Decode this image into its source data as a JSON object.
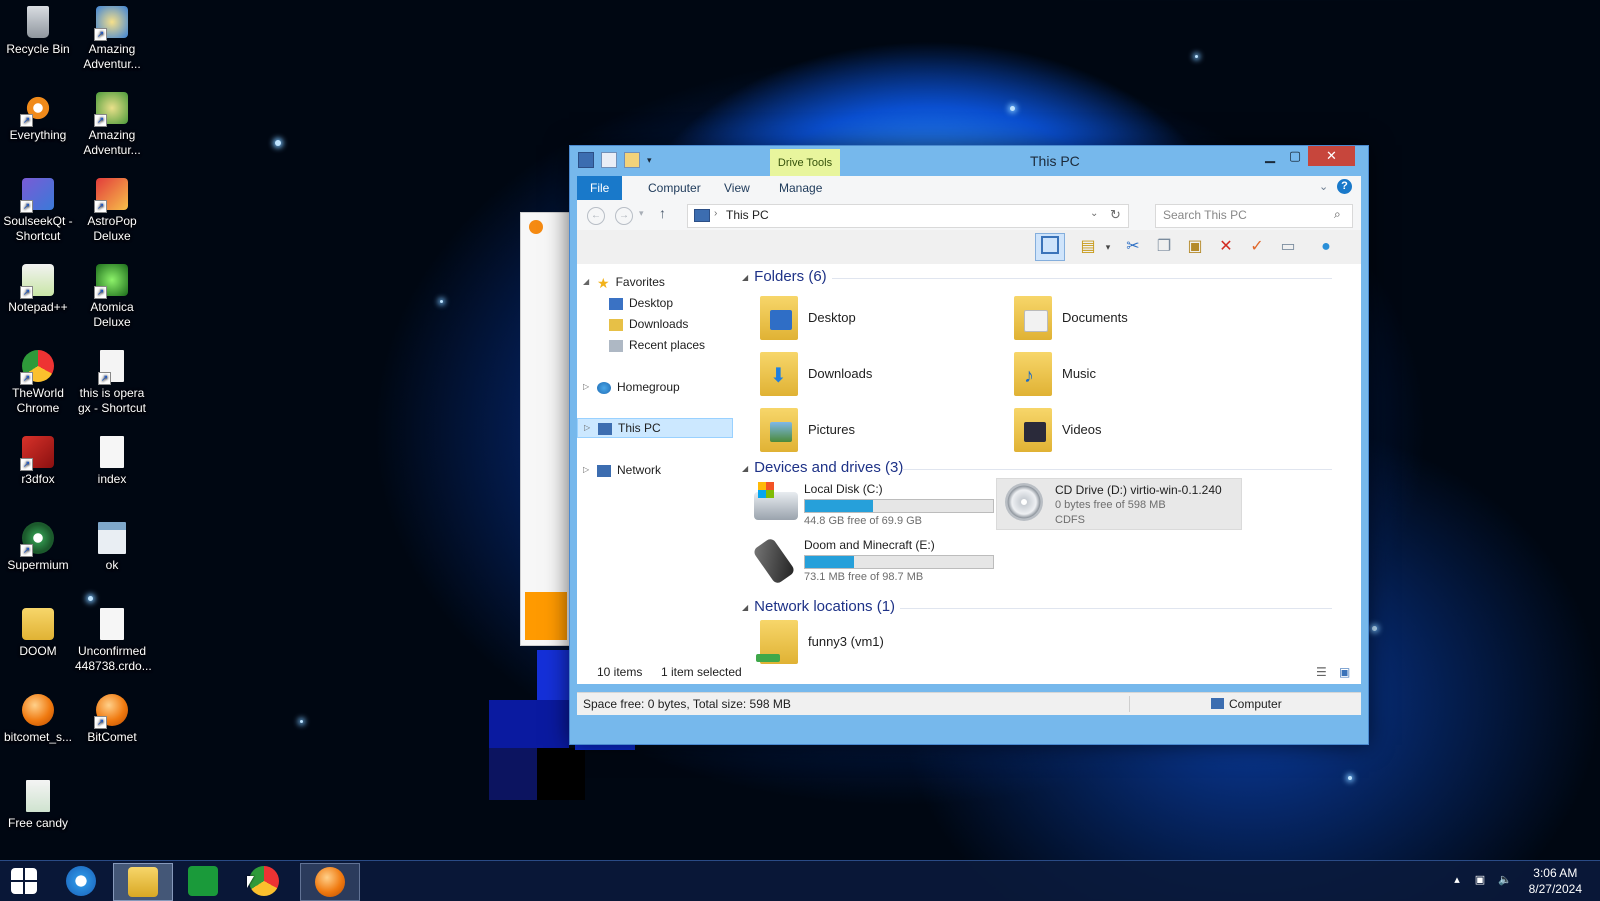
{
  "desktop": {
    "icons": [
      {
        "label": "Recycle Bin",
        "icon": "recycle-bin-icon"
      },
      {
        "label": "Amazing Adventur...",
        "icon": "game-icon"
      },
      {
        "label": "Everything",
        "icon": "everything-icon"
      },
      {
        "label": "Amazing Adventur...",
        "icon": "game-icon"
      },
      {
        "label": "SoulseekQt - Shortcut",
        "icon": "soulseek-icon"
      },
      {
        "label": "AstroPop Deluxe",
        "icon": "astropop-icon"
      },
      {
        "label": "Notepad++",
        "icon": "notepad-plus-plus-icon"
      },
      {
        "label": "Atomica Deluxe",
        "icon": "atomica-icon"
      },
      {
        "label": "TheWorld Chrome",
        "icon": "theworld-chrome-icon"
      },
      {
        "label": "this is opera gx - Shortcut",
        "icon": "file-shortcut-icon"
      },
      {
        "label": "r3dfox",
        "icon": "r3dfox-icon"
      },
      {
        "label": "index",
        "icon": "document-icon"
      },
      {
        "label": "Supermium",
        "icon": "supermium-icon"
      },
      {
        "label": "ok",
        "icon": "window-icon"
      },
      {
        "label": "DOOM",
        "icon": "folder-icon"
      },
      {
        "label": "Unconfirmed 448738.crdo...",
        "icon": "document-icon"
      },
      {
        "label": "bitcomet_s...",
        "icon": "bitcomet-icon"
      },
      {
        "label": "BitComet",
        "icon": "bitcomet-icon"
      },
      {
        "label": "Free candy",
        "icon": "script-icon"
      }
    ]
  },
  "explorer": {
    "title": "This PC",
    "context_tab": "Drive Tools",
    "ribbon_tabs": [
      "File",
      "Computer",
      "View",
      "Manage"
    ],
    "address": "This PC",
    "search_placeholder": "Search This PC",
    "nav": {
      "favorites": "Favorites",
      "desktop": "Desktop",
      "downloads": "Downloads",
      "recent": "Recent places",
      "homegroup": "Homegroup",
      "this_pc": "This PC",
      "network": "Network"
    },
    "sections": {
      "folders": "Folders (6)",
      "devices": "Devices and drives (3)",
      "network": "Network locations (1)"
    },
    "folders": [
      {
        "name": "Desktop",
        "icon": "desktop-folder-icon"
      },
      {
        "name": "Documents",
        "icon": "documents-folder-icon"
      },
      {
        "name": "Downloads",
        "icon": "downloads-folder-icon"
      },
      {
        "name": "Music",
        "icon": "music-folder-icon"
      },
      {
        "name": "Pictures",
        "icon": "pictures-folder-icon"
      },
      {
        "name": "Videos",
        "icon": "videos-folder-icon"
      }
    ],
    "drives": [
      {
        "name": "Local Disk (C:)",
        "sub": "44.8 GB free of 69.9 GB",
        "used_fraction": 0.36,
        "icon": "hard-disk-icon"
      },
      {
        "name": "CD Drive (D:) virtio-win-0.1.240",
        "sub": "0 bytes free of 598 MB",
        "sub2": "CDFS",
        "icon": "cd-drive-icon"
      },
      {
        "name": "Doom and Minecraft (E:)",
        "sub": "73.1 MB free of 98.7 MB",
        "used_fraction": 0.26,
        "icon": "usb-drive-icon"
      }
    ],
    "network_locations": [
      {
        "name": "funny3 (vm1)",
        "icon": "network-folder-icon"
      }
    ],
    "status": {
      "items": "10 items",
      "selected": "1 item selected"
    },
    "bottom": {
      "space": "Space free: 0 bytes, Total size: 598 MB",
      "zone": "Computer"
    }
  },
  "taskbar": {
    "time": "3:06 AM",
    "date": "8/27/2024"
  }
}
